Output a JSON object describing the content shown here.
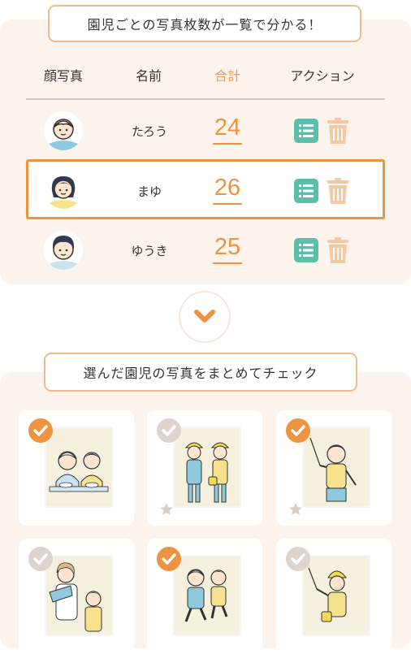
{
  "banner_top": "園児ごとの写真枚数が一覧で分かる！",
  "table": {
    "headers": {
      "photo": "顔写真",
      "name": "名前",
      "total": "合計",
      "action": "アクション"
    },
    "rows": [
      {
        "name": "たろう",
        "count": "24",
        "selected": false
      },
      {
        "name": "まゆ",
        "count": "26",
        "selected": true
      },
      {
        "name": "ゆうき",
        "count": "25",
        "selected": false
      }
    ]
  },
  "expand_icon": "chevron-down-icon",
  "banner_bottom": "選んだ園児の写真をまとめてチェック",
  "photos": [
    {
      "checked": true,
      "starred": false,
      "scene": "two children eating lunch"
    },
    {
      "checked": false,
      "starred": true,
      "scene": "two children in yellow hats"
    },
    {
      "checked": true,
      "starred": true,
      "scene": "girl raising hand"
    },
    {
      "checked": false,
      "starred": false,
      "scene": "teacher with child"
    },
    {
      "checked": true,
      "starred": false,
      "scene": "two children walking"
    },
    {
      "checked": false,
      "starred": false,
      "scene": "child in yellow hat"
    }
  ],
  "colors": {
    "accent": "#ee9340",
    "list_button": "#5bbfa9",
    "trash": "#f5c8a4",
    "panel_bg": "#fdf3ed"
  }
}
